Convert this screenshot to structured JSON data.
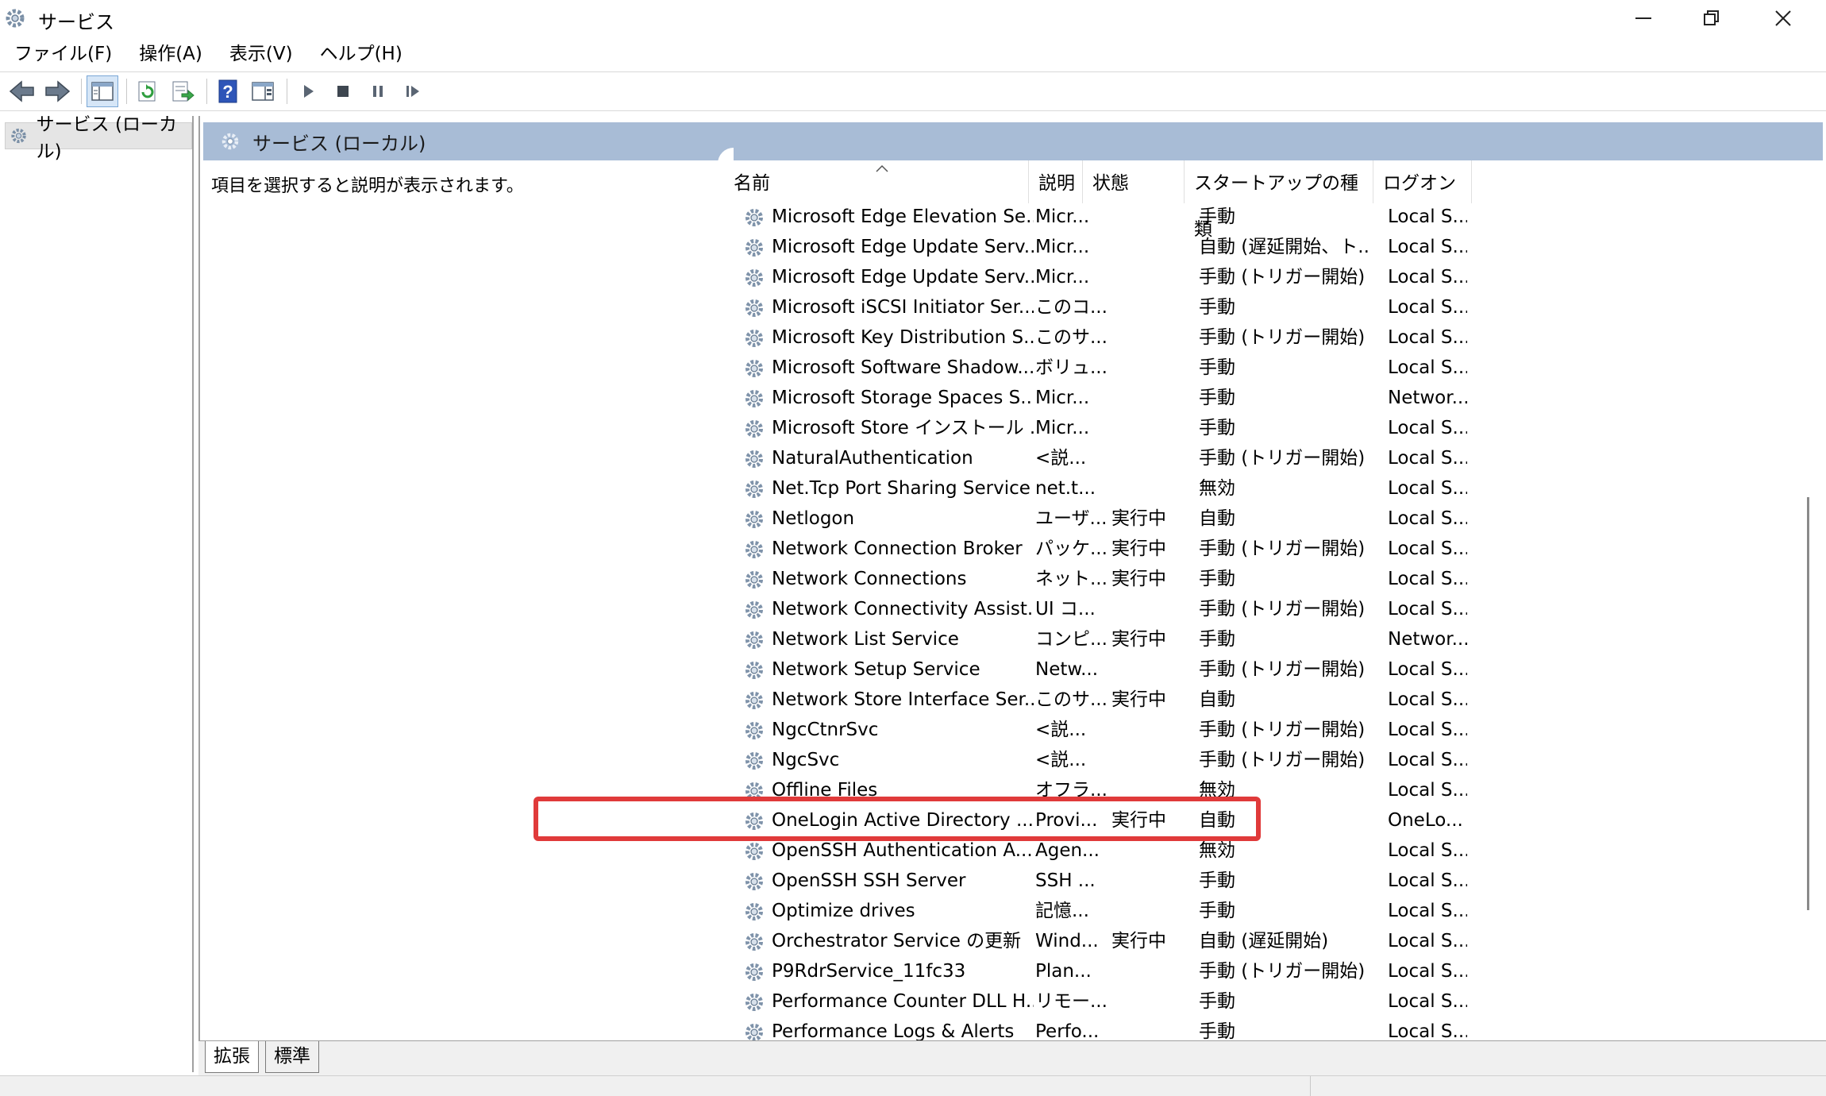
{
  "window": {
    "title": "サービス"
  },
  "menu": [
    "ファイル(F)",
    "操作(A)",
    "表示(V)",
    "ヘルプ(H)"
  ],
  "tree": {
    "root_label": "サービス (ローカル)"
  },
  "main": {
    "header": "サービス (ローカル)",
    "description": "項目を選択すると説明が表示されます。"
  },
  "columns": {
    "name": "名前",
    "desc": "説明",
    "state": "状態",
    "startup": "スタートアップの種類",
    "logon": "ログオン"
  },
  "rows": [
    {
      "name": "Microsoft Edge Elevation Se...",
      "desc": "Micr...",
      "state": "",
      "startup": "手動",
      "logon": "Local S..."
    },
    {
      "name": "Microsoft Edge Update Serv...",
      "desc": "Micr...",
      "state": "",
      "startup": "自動 (遅延開始、ト...",
      "logon": "Local S..."
    },
    {
      "name": "Microsoft Edge Update Serv...",
      "desc": "Micr...",
      "state": "",
      "startup": "手動 (トリガー開始)",
      "logon": "Local S..."
    },
    {
      "name": "Microsoft iSCSI Initiator Ser...",
      "desc": "このコ...",
      "state": "",
      "startup": "手動",
      "logon": "Local S..."
    },
    {
      "name": "Microsoft Key Distribution S...",
      "desc": "このサ...",
      "state": "",
      "startup": "手動 (トリガー開始)",
      "logon": "Local S..."
    },
    {
      "name": "Microsoft Software Shadow...",
      "desc": "ボリュ...",
      "state": "",
      "startup": "手動",
      "logon": "Local S..."
    },
    {
      "name": "Microsoft Storage Spaces S...",
      "desc": "Micr...",
      "state": "",
      "startup": "手動",
      "logon": "Networ..."
    },
    {
      "name": "Microsoft Store インストール ...",
      "desc": "Micr...",
      "state": "",
      "startup": "手動",
      "logon": "Local S..."
    },
    {
      "name": "NaturalAuthentication",
      "desc": "<説...",
      "state": "",
      "startup": "手動 (トリガー開始)",
      "logon": "Local S..."
    },
    {
      "name": "Net.Tcp Port Sharing Service",
      "desc": "net.t...",
      "state": "",
      "startup": "無効",
      "logon": "Local S..."
    },
    {
      "name": "Netlogon",
      "desc": "ユーザ...",
      "state": "実行中",
      "startup": "自動",
      "logon": "Local S..."
    },
    {
      "name": "Network Connection Broker",
      "desc": "パッケ...",
      "state": "実行中",
      "startup": "手動 (トリガー開始)",
      "logon": "Local S..."
    },
    {
      "name": "Network Connections",
      "desc": "ネット...",
      "state": "実行中",
      "startup": "手動",
      "logon": "Local S..."
    },
    {
      "name": "Network Connectivity Assist...",
      "desc": "UI コ...",
      "state": "",
      "startup": "手動 (トリガー開始)",
      "logon": "Local S..."
    },
    {
      "name": "Network List Service",
      "desc": "コンピ...",
      "state": "実行中",
      "startup": "手動",
      "logon": "Networ..."
    },
    {
      "name": "Network Setup Service",
      "desc": "Netw...",
      "state": "",
      "startup": "手動 (トリガー開始)",
      "logon": "Local S..."
    },
    {
      "name": "Network Store Interface Ser...",
      "desc": "このサ...",
      "state": "実行中",
      "startup": "自動",
      "logon": "Local S..."
    },
    {
      "name": "NgcCtnrSvc",
      "desc": "<説...",
      "state": "",
      "startup": "手動 (トリガー開始)",
      "logon": "Local S..."
    },
    {
      "name": "NgcSvc",
      "desc": "<説...",
      "state": "",
      "startup": "手動 (トリガー開始)",
      "logon": "Local S..."
    },
    {
      "name": "Offline Files",
      "desc": "オフラ...",
      "state": "",
      "startup": "無効",
      "logon": "Local S..."
    },
    {
      "name": "OneLogin Active Directory ...",
      "desc": "Provi...",
      "state": "実行中",
      "startup": "自動",
      "logon": "OneLo..."
    },
    {
      "name": "OpenSSH Authentication A...",
      "desc": "Agen...",
      "state": "",
      "startup": "無効",
      "logon": "Local S..."
    },
    {
      "name": "OpenSSH SSH Server",
      "desc": "SSH ...",
      "state": "",
      "startup": "手動",
      "logon": "Local S..."
    },
    {
      "name": "Optimize drives",
      "desc": "記憶...",
      "state": "",
      "startup": "手動",
      "logon": "Local S..."
    },
    {
      "name": "Orchestrator Service の更新",
      "desc": "Wind...",
      "state": "実行中",
      "startup": "自動 (遅延開始)",
      "logon": "Local S..."
    },
    {
      "name": "P9RdrService_11fc33",
      "desc": "Plan...",
      "state": "",
      "startup": "手動 (トリガー開始)",
      "logon": "Local S..."
    },
    {
      "name": "Performance Counter DLL H...",
      "desc": "リモー...",
      "state": "",
      "startup": "手動",
      "logon": "Local S..."
    },
    {
      "name": "Performance Logs & Alerts",
      "desc": "Perfo...",
      "state": "",
      "startup": "手動",
      "logon": "Local S..."
    }
  ],
  "tabs": [
    "拡張",
    "標準"
  ],
  "icons": {
    "toolbar": [
      "back-arrow-icon",
      "forward-arrow-icon",
      "console-tree-icon",
      "refresh-icon",
      "export-list-icon",
      "help-icon",
      "properties-icon",
      "start-service-icon",
      "stop-service-icon",
      "pause-service-icon",
      "resume-service-icon"
    ],
    "row": "gear-icon"
  },
  "colors": {
    "header_band": "#a8bcd6",
    "highlight": "#e03a3a"
  }
}
